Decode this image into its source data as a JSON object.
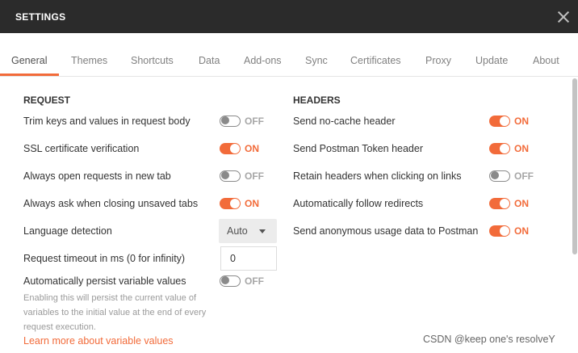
{
  "dialog": {
    "title": "SETTINGS"
  },
  "tabs": [
    {
      "label": "General",
      "active": true
    },
    {
      "label": "Themes"
    },
    {
      "label": "Shortcuts"
    },
    {
      "label": "Data"
    },
    {
      "label": "Add-ons"
    },
    {
      "label": "Sync"
    },
    {
      "label": "Certificates"
    },
    {
      "label": "Proxy"
    },
    {
      "label": "Update"
    },
    {
      "label": "About"
    }
  ],
  "request": {
    "heading": "REQUEST",
    "trim_keys": {
      "label": "Trim keys and values in request body",
      "state": "OFF"
    },
    "ssl": {
      "label": "SSL certificate verification",
      "state": "ON"
    },
    "new_tab": {
      "label": "Always open requests in new tab",
      "state": "OFF"
    },
    "ask_close": {
      "label": "Always ask when closing unsaved tabs",
      "state": "ON"
    },
    "language": {
      "label": "Language detection",
      "value": "Auto"
    },
    "timeout": {
      "label": "Request timeout in ms (0 for infinity)",
      "value": "0"
    },
    "persist": {
      "label": "Automatically persist variable values",
      "state": "OFF",
      "help": "Enabling this will persist the current value of variables to the initial value at the end of every request execution.",
      "link": "Learn more about variable values"
    }
  },
  "headers": {
    "heading": "HEADERS",
    "no_cache": {
      "label": "Send no-cache header",
      "state": "ON"
    },
    "postman_token": {
      "label": "Send Postman Token header",
      "state": "ON"
    },
    "retain": {
      "label": "Retain headers when clicking on links",
      "state": "OFF"
    },
    "redirects": {
      "label": "Automatically follow redirects",
      "state": "ON"
    },
    "anonymous": {
      "label": "Send anonymous usage data to Postman",
      "state": "ON"
    }
  },
  "watermark": "CSDN @keep one's resolveY",
  "colors": {
    "accent": "#f26b3a",
    "titlebar": "#2b2b2b"
  }
}
